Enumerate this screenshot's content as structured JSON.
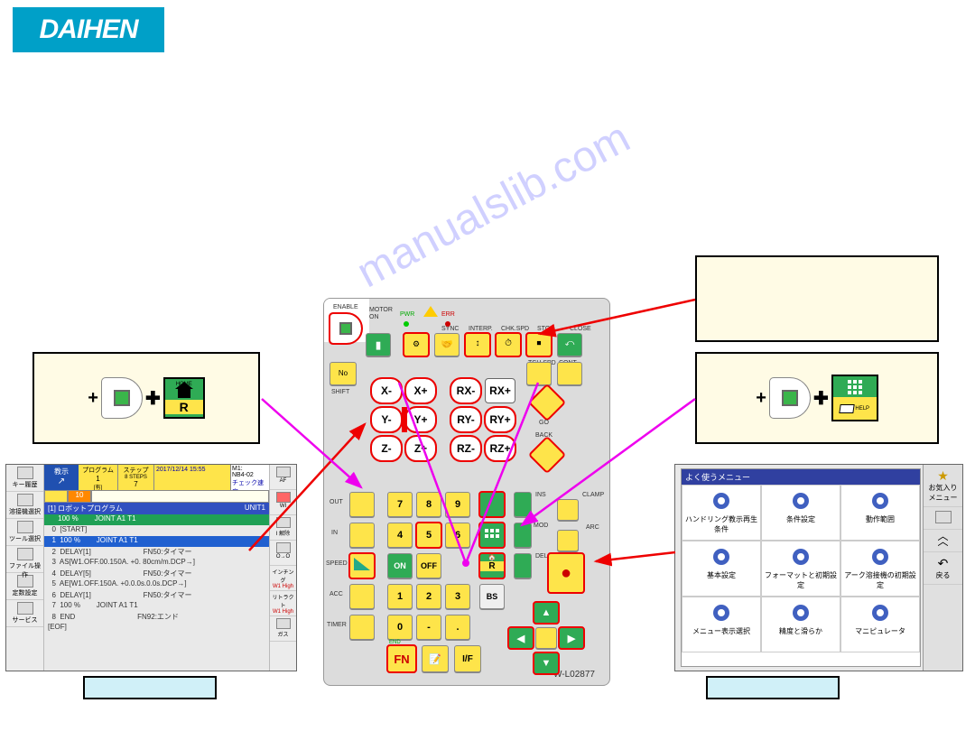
{
  "logo": "DAIHEN",
  "watermark": "manualslib.com",
  "pendant": {
    "part_no": "W-L02877",
    "labels": {
      "enable": "ENABLE",
      "motor": "MOTOR",
      "on": "ON",
      "pwr": "PWR",
      "err": "ERR",
      "sync": "SYNC",
      "interp": "INTERP.",
      "chkspd": "CHK.SPD",
      "stop": "STOP",
      "close": "CLOSE",
      "shift": "SHIFT",
      "out": "OUT",
      "in": "IN",
      "speed": "SPEED",
      "acc": "ACC",
      "timer": "TIMER",
      "go": "GO",
      "back": "BACK",
      "ins": "INS",
      "mod": "MOD",
      "del": "DEL",
      "clamp": "CLAMP",
      "arc": "ARC",
      "tchspd": "TCH.SPD",
      "cont": "CONT"
    },
    "jog": {
      "xm": "X-",
      "xp": "X+",
      "ym": "Y-",
      "yp": "Y+",
      "zm": "Z-",
      "zp": "Z+",
      "rxm": "RX-",
      "rxp": "RX+",
      "rym": "RY-",
      "ryp": "RY+",
      "rzm": "RZ-",
      "rzp": "RZ+"
    },
    "keypad": [
      "7",
      "8",
      "9",
      "4",
      "5",
      "6",
      "1",
      "2",
      "3",
      "0",
      "-",
      ".",
      "BS"
    ],
    "keys": {
      "on_label": "ON",
      "off_label": "OFF",
      "fn": "FN",
      "if": "I/F",
      "end": "END",
      "home_r": "R",
      "home_txt": "HOME",
      "rec": "●"
    }
  },
  "callout_left": {
    "home_label": "HOME",
    "r_label": "R"
  },
  "callout_right": {
    "menu_label": "MENU",
    "help_label": "HELP"
  },
  "screen_left": {
    "header": {
      "title1": "教示",
      "program": "プログラム",
      "step": "ステップ",
      "datetime": "2017/12/14  15:55",
      "prog_val": "1",
      "prog_sub": "[有]",
      "step_val": "8 STEPS",
      "step_sub": "7",
      "m1": "M1:",
      "mval": "NB4-02",
      "check": "チェック速度"
    },
    "row80_label": "10",
    "bar_title": "[1] ロボットプログラム",
    "bar_right": "UNIT1",
    "lines": [
      "     100 %        JOINT A1 T1",
      "  0  [START]",
      "  1  100 %        JOINT A1 T1",
      "  2  DELAY[1]                          FN50:タイマー",
      "  3  AS[W1.OFF.00.150A. +0. 80cm/m.DCP→]",
      "  4  DELAY[5]                          FN50:タイマー",
      "  5  AE[W1.OFF.150A. +0.0.0s.0.0s.DCP→]",
      "  6  DELAY[1]                          FN50:タイマー",
      "  7  100 %        JOINT A1 T1",
      "  8  END                               FN92:エンド",
      "[EOF]"
    ],
    "left_icons": [
      "キー履歴",
      "溶接機選択",
      "ツール選択",
      "ファイル操作",
      "定数設定",
      "サービス"
    ],
    "right_icons": [
      "AF",
      "WI",
      "I 解除",
      "O→O",
      "インチング",
      "W1  High",
      "リトラクト",
      "W1  High",
      "ガス"
    ]
  },
  "screen_right": {
    "title": "よく使うメニュー",
    "cells": [
      "ハンドリング教示再生条件",
      "条件設定",
      "動作範囲",
      "基本設定",
      "フォーマットと初期設定",
      "アーク溶接機の初期設定",
      "メニュー表示選択",
      "精度と滑らか",
      "マニピュレータ"
    ],
    "sidebar": [
      "お気入りメニュー",
      "",
      "",
      "戻る"
    ],
    "sidebar_icons": [
      "star",
      "blank",
      "up",
      "back"
    ]
  }
}
